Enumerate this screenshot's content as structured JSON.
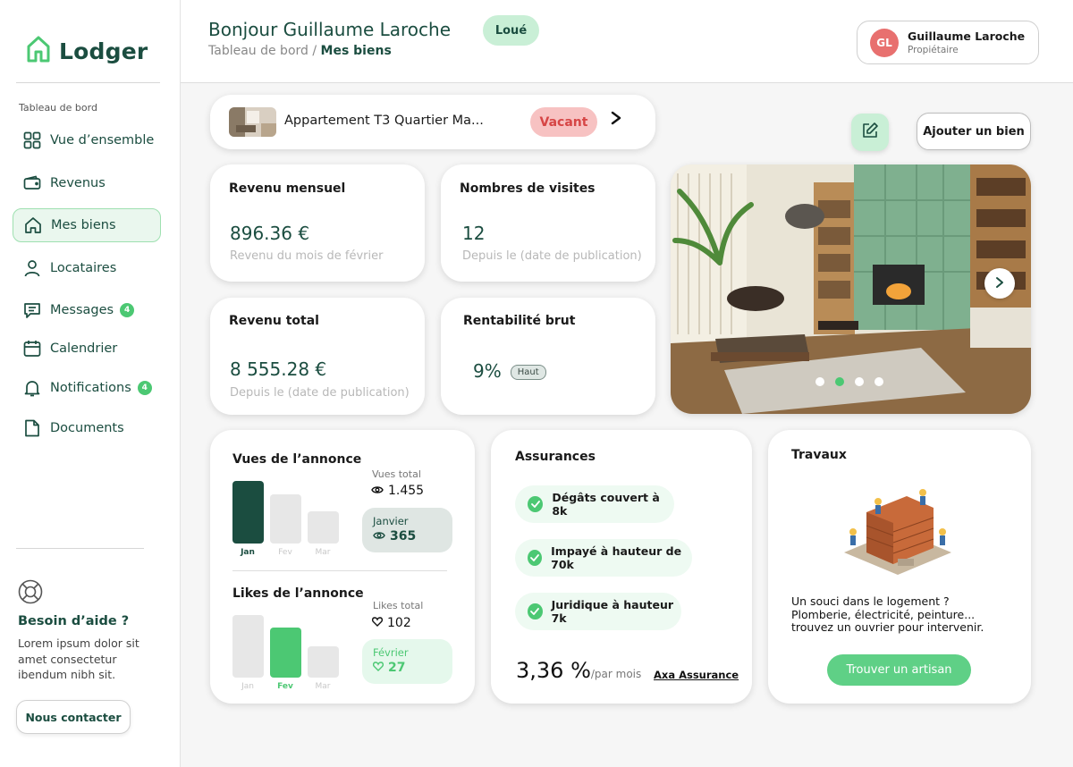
{
  "brand": {
    "name": "Lodger",
    "accent": "#1b4d40",
    "green": "#4cc873"
  },
  "sidebar": {
    "section_label": "Tableau de bord",
    "items": [
      {
        "label": "Vue d’ensemble",
        "icon": "grid-icon"
      },
      {
        "label": "Revenus",
        "icon": "wallet-icon"
      },
      {
        "label": "Mes biens",
        "icon": "home-icon",
        "active": true
      },
      {
        "label": "Locataires",
        "icon": "user-icon"
      },
      {
        "label": "Messages",
        "icon": "message-icon",
        "badge": "4"
      },
      {
        "label": "Calendrier",
        "icon": "calendar-icon"
      },
      {
        "label": "Notifications",
        "icon": "bell-icon",
        "badge": "4"
      },
      {
        "label": "Documents",
        "icon": "document-icon"
      }
    ],
    "help": {
      "title": "Besoin d’aide ?",
      "text": "Lorem ipsum dolor sit amet consectetur ibendum nibh sit.",
      "button": "Nous contacter"
    }
  },
  "header": {
    "greeting": "Bonjour Guillaume Laroche",
    "breadcrumb_root": "Tableau de bord",
    "breadcrumb_sep": "/",
    "breadcrumb_current": "Mes biens",
    "status_pill": "Loué",
    "user": {
      "initials": "GL",
      "name": "Guillaume Laroche",
      "role": "Propiétaire"
    }
  },
  "property": {
    "name": "Appartement T3 Quartier Ma...",
    "status": "Vacant",
    "add_button": "Ajouter un bien"
  },
  "stats": {
    "monthly": {
      "title": "Revenu mensuel",
      "value": "896.36 €",
      "sub": "Revenu du mois de février"
    },
    "visits": {
      "title": "Nombres de visites",
      "value": "12",
      "sub": "Depuis le (date de publication)"
    },
    "total": {
      "title": "Revenu total",
      "value": "8 555.28 €",
      "sub": "Depuis le (date de publication)"
    },
    "yield": {
      "title": "Rentabilité brut",
      "value": "9%",
      "tag": "Haut"
    }
  },
  "gallery": {
    "slides": 4,
    "active_slide": 2
  },
  "views": {
    "title": "Vues de l’annonce",
    "months": [
      "Jan",
      "Fev",
      "Mar"
    ],
    "values_relative": [
      1.0,
      0.79,
      0.51
    ],
    "highlight": 0,
    "total_label": "Vues total",
    "total_value": "1.455",
    "month_label": "Janvier",
    "month_value": "365"
  },
  "likes": {
    "title": "Likes de l’annonce",
    "months": [
      "Jan",
      "Fev",
      "Mar"
    ],
    "values_relative": [
      1.0,
      0.8,
      0.5
    ],
    "highlight": 1,
    "total_label": "Likes total",
    "total_value": "102",
    "month_label": "Février",
    "month_value": "27"
  },
  "insurance": {
    "title": "Assurances",
    "items": [
      "Dégâts couvert à 8k",
      "Impayé à hauteur de 70k",
      "Juridique à hauteur 7k"
    ],
    "rate": "3,36 %",
    "rate_unit": "/par mois",
    "provider": "Axa Assurance"
  },
  "works": {
    "title": "Travaux",
    "text_lines": [
      "Un souci dans le logement ?",
      "Plomberie, électricité, peinture...",
      "trouvez un ouvrier pour intervenir."
    ],
    "button": "Trouver un artisan"
  }
}
